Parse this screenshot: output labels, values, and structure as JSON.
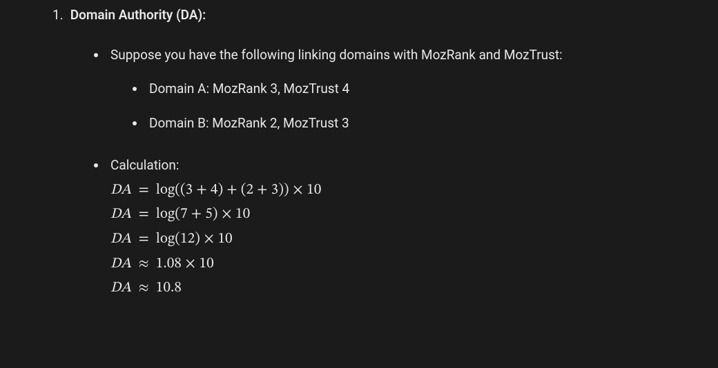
{
  "item": {
    "number": "1.",
    "title": "Domain Authority (DA):"
  },
  "intro": "Suppose you have the following linking domains with MozRank and MozTrust:",
  "domains": {
    "a": "Domain A: MozRank 3, MozTrust 4",
    "b": "Domain B: MozRank 2, MozTrust 3"
  },
  "calc_label": "Calculation:",
  "calc": {
    "var": "DA",
    "eq": "=",
    "approx": "≈",
    "line1_rhs": "log((3 + 4) + (2 + 3)) × 10",
    "line2_rhs": "log(7 + 5) × 10",
    "line3_rhs": "log(12) × 10",
    "line4_rhs": "1.08 × 10",
    "line5_rhs": "10.8"
  }
}
